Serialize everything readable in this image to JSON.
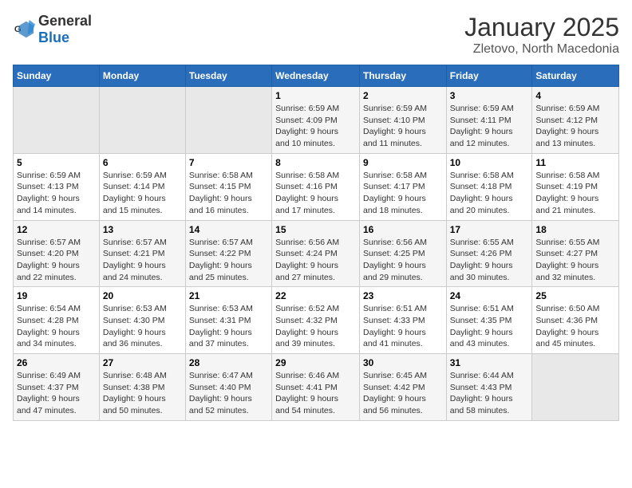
{
  "header": {
    "logo": {
      "general": "General",
      "blue": "Blue"
    },
    "title": "January 2025",
    "subtitle": "Zletovo, North Macedonia"
  },
  "calendar": {
    "days_of_week": [
      "Sunday",
      "Monday",
      "Tuesday",
      "Wednesday",
      "Thursday",
      "Friday",
      "Saturday"
    ],
    "weeks": [
      [
        {
          "day": "",
          "info": ""
        },
        {
          "day": "",
          "info": ""
        },
        {
          "day": "",
          "info": ""
        },
        {
          "day": "1",
          "info": "Sunrise: 6:59 AM\nSunset: 4:09 PM\nDaylight: 9 hours\nand 10 minutes."
        },
        {
          "day": "2",
          "info": "Sunrise: 6:59 AM\nSunset: 4:10 PM\nDaylight: 9 hours\nand 11 minutes."
        },
        {
          "day": "3",
          "info": "Sunrise: 6:59 AM\nSunset: 4:11 PM\nDaylight: 9 hours\nand 12 minutes."
        },
        {
          "day": "4",
          "info": "Sunrise: 6:59 AM\nSunset: 4:12 PM\nDaylight: 9 hours\nand 13 minutes."
        }
      ],
      [
        {
          "day": "5",
          "info": "Sunrise: 6:59 AM\nSunset: 4:13 PM\nDaylight: 9 hours\nand 14 minutes."
        },
        {
          "day": "6",
          "info": "Sunrise: 6:59 AM\nSunset: 4:14 PM\nDaylight: 9 hours\nand 15 minutes."
        },
        {
          "day": "7",
          "info": "Sunrise: 6:58 AM\nSunset: 4:15 PM\nDaylight: 9 hours\nand 16 minutes."
        },
        {
          "day": "8",
          "info": "Sunrise: 6:58 AM\nSunset: 4:16 PM\nDaylight: 9 hours\nand 17 minutes."
        },
        {
          "day": "9",
          "info": "Sunrise: 6:58 AM\nSunset: 4:17 PM\nDaylight: 9 hours\nand 18 minutes."
        },
        {
          "day": "10",
          "info": "Sunrise: 6:58 AM\nSunset: 4:18 PM\nDaylight: 9 hours\nand 20 minutes."
        },
        {
          "day": "11",
          "info": "Sunrise: 6:58 AM\nSunset: 4:19 PM\nDaylight: 9 hours\nand 21 minutes."
        }
      ],
      [
        {
          "day": "12",
          "info": "Sunrise: 6:57 AM\nSunset: 4:20 PM\nDaylight: 9 hours\nand 22 minutes."
        },
        {
          "day": "13",
          "info": "Sunrise: 6:57 AM\nSunset: 4:21 PM\nDaylight: 9 hours\nand 24 minutes."
        },
        {
          "day": "14",
          "info": "Sunrise: 6:57 AM\nSunset: 4:22 PM\nDaylight: 9 hours\nand 25 minutes."
        },
        {
          "day": "15",
          "info": "Sunrise: 6:56 AM\nSunset: 4:24 PM\nDaylight: 9 hours\nand 27 minutes."
        },
        {
          "day": "16",
          "info": "Sunrise: 6:56 AM\nSunset: 4:25 PM\nDaylight: 9 hours\nand 29 minutes."
        },
        {
          "day": "17",
          "info": "Sunrise: 6:55 AM\nSunset: 4:26 PM\nDaylight: 9 hours\nand 30 minutes."
        },
        {
          "day": "18",
          "info": "Sunrise: 6:55 AM\nSunset: 4:27 PM\nDaylight: 9 hours\nand 32 minutes."
        }
      ],
      [
        {
          "day": "19",
          "info": "Sunrise: 6:54 AM\nSunset: 4:28 PM\nDaylight: 9 hours\nand 34 minutes."
        },
        {
          "day": "20",
          "info": "Sunrise: 6:53 AM\nSunset: 4:30 PM\nDaylight: 9 hours\nand 36 minutes."
        },
        {
          "day": "21",
          "info": "Sunrise: 6:53 AM\nSunset: 4:31 PM\nDaylight: 9 hours\nand 37 minutes."
        },
        {
          "day": "22",
          "info": "Sunrise: 6:52 AM\nSunset: 4:32 PM\nDaylight: 9 hours\nand 39 minutes."
        },
        {
          "day": "23",
          "info": "Sunrise: 6:51 AM\nSunset: 4:33 PM\nDaylight: 9 hours\nand 41 minutes."
        },
        {
          "day": "24",
          "info": "Sunrise: 6:51 AM\nSunset: 4:35 PM\nDaylight: 9 hours\nand 43 minutes."
        },
        {
          "day": "25",
          "info": "Sunrise: 6:50 AM\nSunset: 4:36 PM\nDaylight: 9 hours\nand 45 minutes."
        }
      ],
      [
        {
          "day": "26",
          "info": "Sunrise: 6:49 AM\nSunset: 4:37 PM\nDaylight: 9 hours\nand 47 minutes."
        },
        {
          "day": "27",
          "info": "Sunrise: 6:48 AM\nSunset: 4:38 PM\nDaylight: 9 hours\nand 50 minutes."
        },
        {
          "day": "28",
          "info": "Sunrise: 6:47 AM\nSunset: 4:40 PM\nDaylight: 9 hours\nand 52 minutes."
        },
        {
          "day": "29",
          "info": "Sunrise: 6:46 AM\nSunset: 4:41 PM\nDaylight: 9 hours\nand 54 minutes."
        },
        {
          "day": "30",
          "info": "Sunrise: 6:45 AM\nSunset: 4:42 PM\nDaylight: 9 hours\nand 56 minutes."
        },
        {
          "day": "31",
          "info": "Sunrise: 6:44 AM\nSunset: 4:43 PM\nDaylight: 9 hours\nand 58 minutes."
        },
        {
          "day": "",
          "info": ""
        }
      ]
    ]
  }
}
